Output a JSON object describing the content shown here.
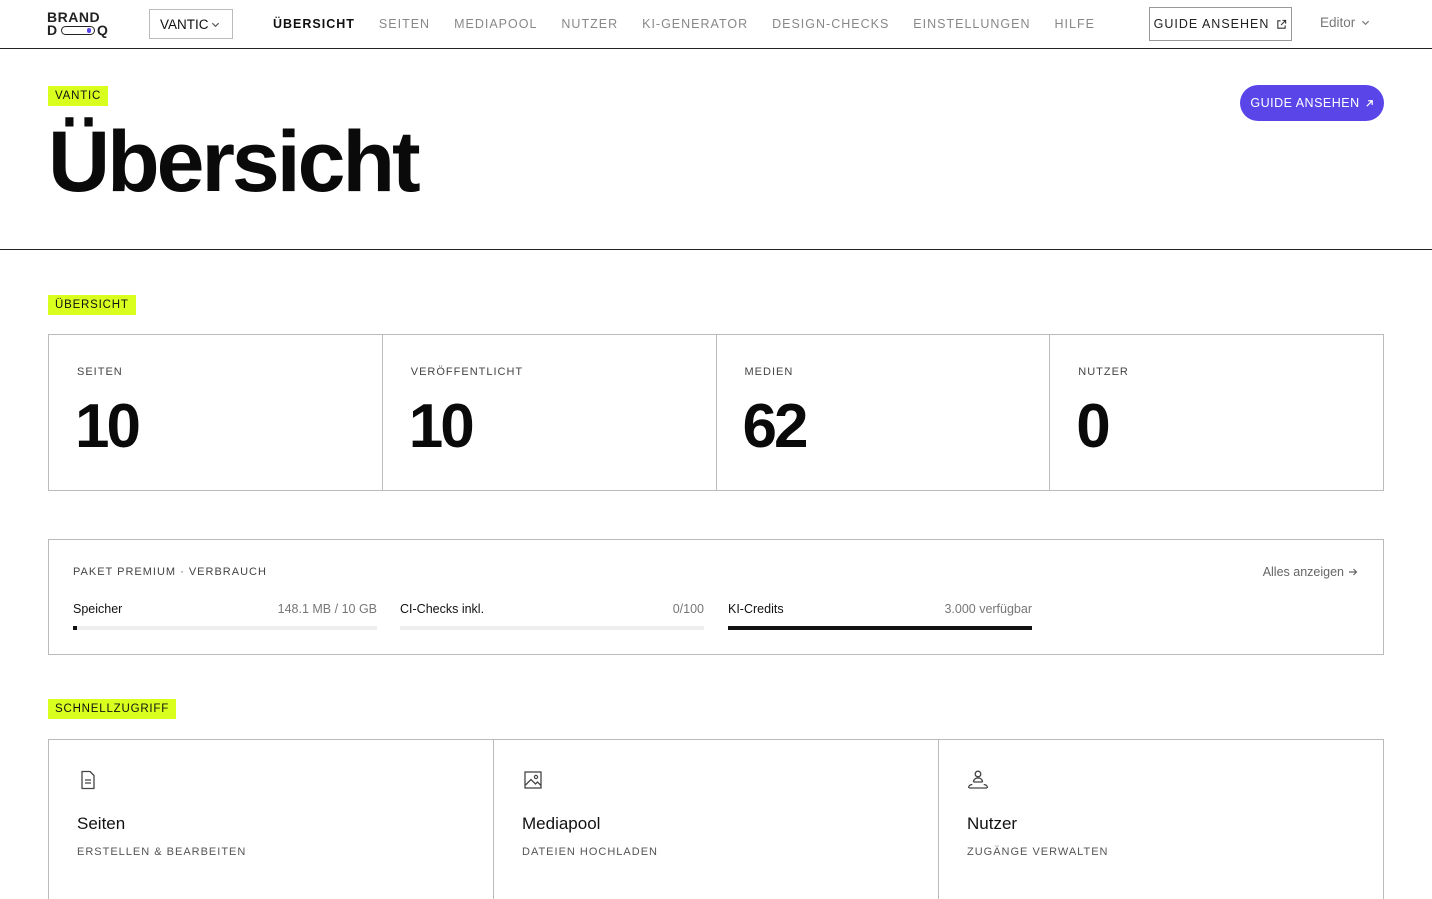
{
  "brand": {
    "logo_line1": "BRAND",
    "logo_line2_left": "D",
    "logo_line2_right": "Q",
    "accent": "#5a46e8",
    "highlight": "#d9ff1f"
  },
  "topbar": {
    "org": "VANTIC",
    "nav": [
      {
        "label": "ÜBERSICHT",
        "active": true
      },
      {
        "label": "SEITEN",
        "active": false
      },
      {
        "label": "MEDIAPOOL",
        "active": false
      },
      {
        "label": "NUTZER",
        "active": false
      },
      {
        "label": "KI-GENERATOR",
        "active": false
      },
      {
        "label": "DESIGN-CHECKS",
        "active": false
      },
      {
        "label": "EINSTELLUNGEN",
        "active": false
      },
      {
        "label": "HILFE",
        "active": false
      }
    ],
    "guide_label": "GUIDE ANSEHEN",
    "role": "Editor"
  },
  "header": {
    "org_tag": "VANTIC",
    "title": "Übersicht",
    "guide_label": "GUIDE ANSEHEN"
  },
  "overview": {
    "tag": "ÜBERSICHT",
    "stats": [
      {
        "label": "SEITEN",
        "value": "10"
      },
      {
        "label": "VERÖFFENTLICHT",
        "value": "10"
      },
      {
        "label": "MEDIEN",
        "value": "62"
      },
      {
        "label": "NUTZER",
        "value": "0"
      }
    ]
  },
  "usage": {
    "title": "PAKET PREMIUM · VERBRAUCH",
    "all_link": "Alles anzeigen",
    "meters": [
      {
        "label": "Speicher",
        "value": "148.1 MB / 10 GB",
        "fraction": 0.0145
      },
      {
        "label": "CI-Checks inkl.",
        "value": "0/100",
        "fraction": 0
      },
      {
        "label": "KI-Credits",
        "value": "3.000 verfügbar",
        "fraction": 1
      }
    ]
  },
  "quick": {
    "tag": "SCHNELLZUGRIFF",
    "cards": [
      {
        "title": "Seiten",
        "subtitle": "ERSTELLEN & BEARBEITEN",
        "icon": "document-icon"
      },
      {
        "title": "Mediapool",
        "subtitle": "DATEIEN HOCHLADEN",
        "icon": "image-icon"
      },
      {
        "title": "Nutzer",
        "subtitle": "ZUGÄNGE VERWALTEN",
        "icon": "users-icon"
      }
    ]
  }
}
